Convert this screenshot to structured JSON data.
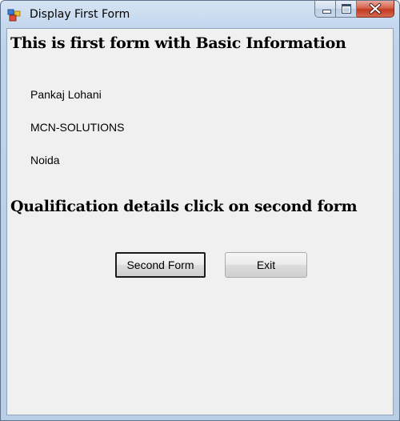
{
  "window": {
    "title": "Display First Form",
    "caption_buttons": [
      "minimize",
      "maximize",
      "close"
    ],
    "close_button_color": "#c7412a"
  },
  "form": {
    "heading": "This is first form with Basic Information",
    "info": {
      "name": "Pankaj Lohani",
      "company": "MCN-SOLUTIONS",
      "city": "Noida"
    },
    "qualification_heading": "Qualification details click on second form",
    "buttons": {
      "second_form": "Second Form",
      "exit": "Exit"
    }
  },
  "icons": {
    "app": "winforms-app-icon",
    "minimize": "minimize-icon",
    "maximize": "maximize-icon",
    "close": "close-icon"
  }
}
